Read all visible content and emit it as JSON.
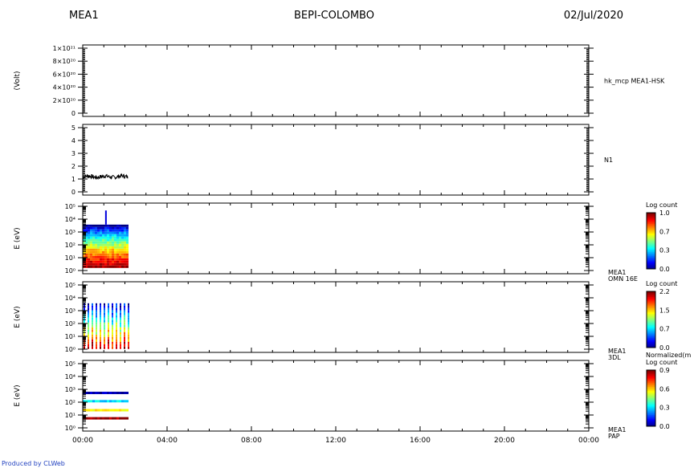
{
  "header": {
    "left": "MEA1",
    "center": "BEPI-COLOMBO",
    "right": "02/Jul/2020"
  },
  "footer": {
    "credit": "Produced by CLWeb"
  },
  "time_axis": {
    "ticks": [
      "00:00",
      "04:00",
      "08:00",
      "12:00",
      "16:00",
      "20:00",
      "00:00"
    ]
  },
  "colors": {
    "axis": "#000000",
    "line": "#000000",
    "spectrogram_low": "#0000ff",
    "spectrogram_high": "#ff0000"
  },
  "chart_data": [
    {
      "type": "line",
      "ylabel": "(Volt)",
      "side_label": [
        "hk_mcp MEA1-HSK"
      ],
      "yticks": [
        "1×10²¹",
        "8×10²⁰",
        "6×10²⁰",
        "4×10²⁰",
        "2×10²⁰",
        "0"
      ],
      "ylim": [
        0,
        1e+21
      ],
      "series": [
        {
          "style": "dashed",
          "x_hours": [
            0,
            24
          ],
          "y": [
            0,
            0
          ]
        }
      ]
    },
    {
      "type": "line",
      "ylabel": "",
      "side_label": [
        "N1"
      ],
      "yticks": [
        "5",
        "4",
        "3",
        "2",
        "1",
        "0"
      ],
      "ylim": [
        0,
        5
      ],
      "series": [
        {
          "style": "noisy",
          "x_hours": [
            0,
            2.15
          ],
          "y_mean": 1.3,
          "y_spread": 0.15
        }
      ]
    },
    {
      "type": "heatmap",
      "ylabel": "E (eV)",
      "side_label": [
        "MEA1",
        "OMN 16E"
      ],
      "yscale": "log",
      "yticks": [
        "10⁵",
        "10⁴",
        "10³",
        "10²",
        "10¹",
        "10⁰"
      ],
      "ylim": [
        1,
        100000
      ],
      "x_range_hours": [
        0,
        2.15
      ],
      "e_range": [
        3,
        3000
      ],
      "colorbar": {
        "title": "Log count",
        "ticks": [
          "1.0",
          "0.7",
          "0.3",
          "0.0"
        ],
        "range": [
          0,
          1.0
        ]
      }
    },
    {
      "type": "heatmap",
      "ylabel": "E (eV)",
      "side_label": [
        "MEA1",
        "3DL"
      ],
      "yscale": "log",
      "yticks": [
        "10⁵",
        "10⁴",
        "10³",
        "10²",
        "10¹",
        "10⁰"
      ],
      "ylim": [
        1,
        100000
      ],
      "x_range_hours": [
        0,
        2.15
      ],
      "e_range": [
        2,
        3000
      ],
      "colorbar": {
        "title": "Log count",
        "top_title": "Normalized(m",
        "ticks": [
          "2.2",
          "1.5",
          "0.7",
          "0.0"
        ],
        "range": [
          0,
          2.2
        ]
      }
    },
    {
      "type": "heatmap",
      "ylabel": "E (eV)",
      "side_label": [
        "MEA1",
        "PAP"
      ],
      "yscale": "log",
      "yticks": [
        "10⁵",
        "10⁴",
        "10³",
        "10²",
        "10¹",
        "10⁰"
      ],
      "ylim": [
        1,
        100000
      ],
      "x_range_hours": [
        0,
        2.15
      ],
      "bands_ev": [
        500,
        130,
        30,
        8
      ],
      "colorbar": {
        "title": "Log count",
        "ticks": [
          "0.9",
          "0.6",
          "0.3",
          "0.0"
        ],
        "range": [
          0,
          0.9
        ]
      }
    }
  ]
}
